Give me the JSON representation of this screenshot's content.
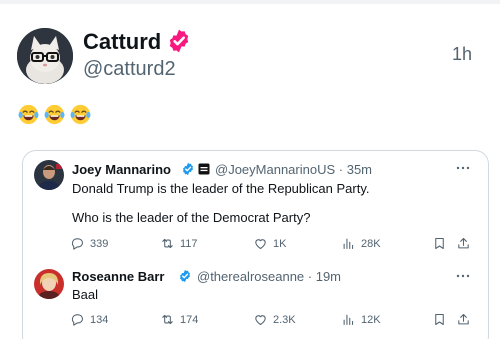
{
  "post": {
    "author_name": "Catturd",
    "author_handle": "@catturd2",
    "time": "1h",
    "emoji_icons": [
      "face-with-tears-of-joy-icon",
      "face-with-tears-of-joy-icon",
      "face-with-tears-of-joy-icon"
    ]
  },
  "replies": [
    {
      "name": "Joey Mannarino",
      "handle": "@JoeyMannarinoUS",
      "time": "35m",
      "lines": [
        "Donald Trump is the leader of the Republican Party.",
        "Who is the leader of the Democrat Party?"
      ],
      "replies_count": "339",
      "reposts_count": "117",
      "likes_count": "1K",
      "views_count": "28K"
    },
    {
      "name": "Roseanne Barr",
      "handle": "@therealroseanne",
      "time": "19m",
      "lines": [
        "Baal"
      ],
      "replies_count": "134",
      "reposts_count": "174",
      "likes_count": "2.3K",
      "views_count": "12K"
    }
  ],
  "colors": {
    "text_primary": "#0f1419",
    "text_secondary": "#536471",
    "verified_blue": "#1d9bf0",
    "verified_pink": "#f91880",
    "border": "#cfd9de"
  }
}
